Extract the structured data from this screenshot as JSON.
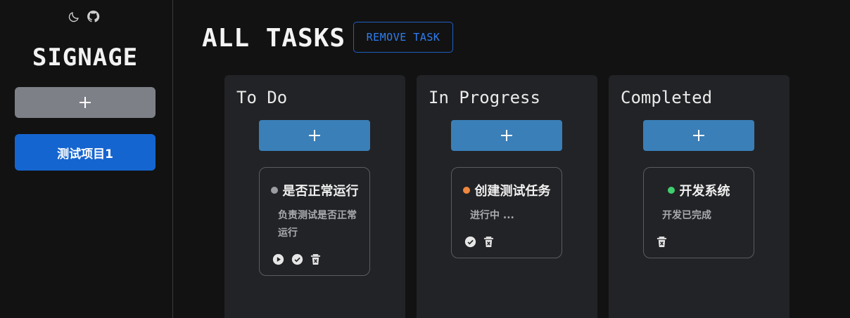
{
  "sidebar": {
    "brand": "SIGNAGE",
    "add_project_icon": "plus-icon",
    "projects": [
      {
        "label": "测试项目1",
        "active": true
      }
    ]
  },
  "header": {
    "title": "ALL TASKS",
    "remove_label": "REMOVE TASK"
  },
  "icons": {
    "theme": "moon-icon",
    "repo": "github-icon"
  },
  "colors": {
    "primary": "#1565d0",
    "column_add": "#3a7fb8",
    "status_todo": "#9b9da3",
    "status_progress": "#f0883e",
    "status_done": "#3fcf6e"
  },
  "columns": [
    {
      "title": "To Do",
      "cards": [
        {
          "title": "是否正常运行",
          "desc": "负责测试是否正常运行",
          "status": "todo",
          "actions": [
            "play",
            "check",
            "delete"
          ]
        }
      ]
    },
    {
      "title": "In Progress",
      "cards": [
        {
          "title": "创建测试任务",
          "desc": "进行中 ...",
          "status": "progress",
          "actions": [
            "check",
            "delete"
          ]
        }
      ]
    },
    {
      "title": "Completed",
      "cards": [
        {
          "title": "开发系统",
          "desc": "开发已完成",
          "status": "done",
          "actions": [
            "delete"
          ]
        }
      ]
    }
  ]
}
